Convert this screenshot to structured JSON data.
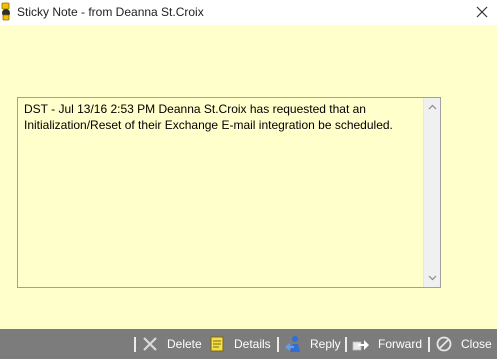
{
  "window": {
    "title": "Sticky Note - from Deanna St.Croix",
    "close_icon": "close-icon"
  },
  "note": {
    "text": "DST - Jul 13/16 2:53 PM  Deanna St.Croix has requested that an Initialization/Reset of their Exchange E-mail integration be scheduled."
  },
  "toolbar": {
    "delete_label": "Delete",
    "details_label": "Details",
    "reply_label": "Reply",
    "forward_label": "Forward",
    "close_label": "Close"
  },
  "colors": {
    "note_background": "#ffffcc",
    "toolbar_background": "#7c7c7c"
  }
}
